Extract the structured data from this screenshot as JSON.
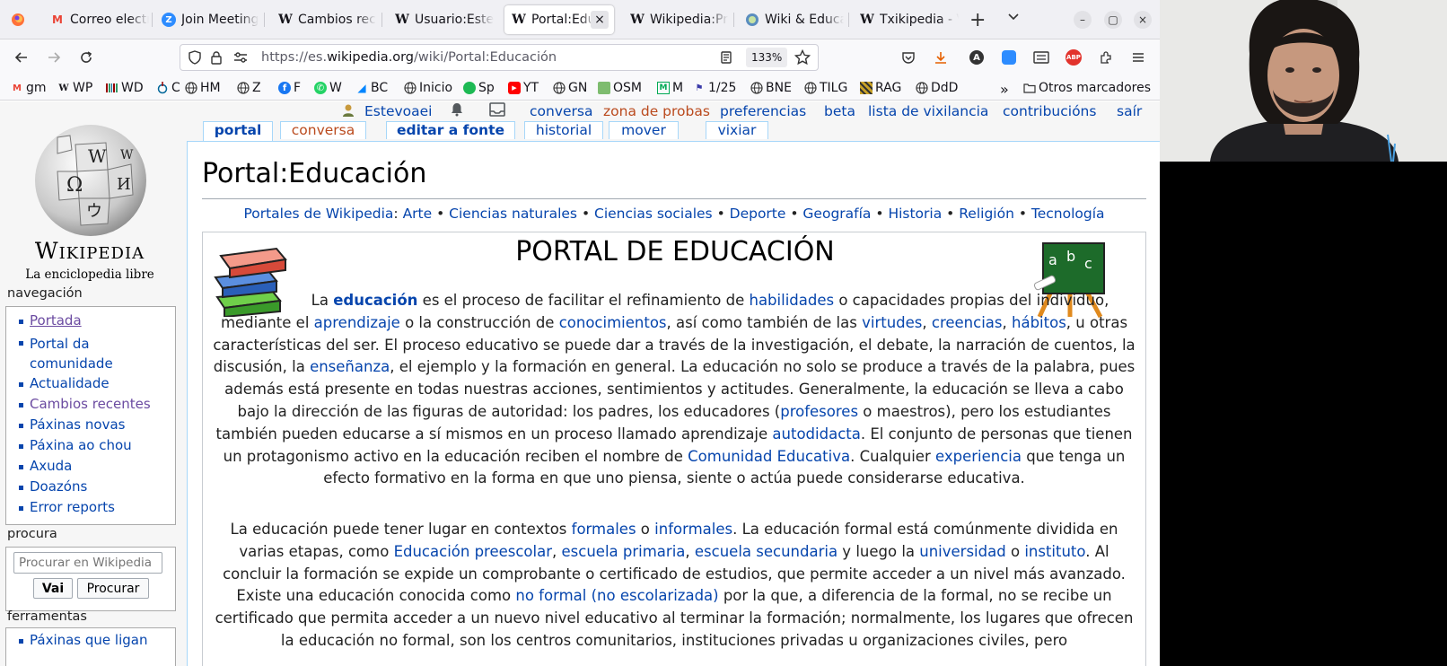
{
  "tabs": [
    {
      "title": "",
      "icon": "firefox-icon"
    },
    {
      "title": "Correo electró",
      "icon": "gmail-icon"
    },
    {
      "title": "Join Meeting",
      "icon": "zoom-icon"
    },
    {
      "title": "Cambios rec",
      "icon": "wikipedia-icon"
    },
    {
      "title": "Usuario:Este",
      "icon": "wikipedia-icon"
    },
    {
      "title": "Portal:Edu",
      "icon": "wikipedia-icon",
      "active": true
    },
    {
      "title": "Wikipedia:Pr",
      "icon": "wikipedia-icon"
    },
    {
      "title": "Wiki & Educa",
      "icon": "wiki-education-icon"
    },
    {
      "title": "Txikipedia - V",
      "icon": "wikipedia-icon"
    }
  ],
  "window_controls": {
    "minimize": "–",
    "maximize": "▢",
    "close": "×"
  },
  "navbar": {
    "url_prefix": "https://es.",
    "url_domain": "wikipedia.org",
    "url_path": "/wiki/Portal:Educación",
    "zoom": "133%"
  },
  "bookmarks": [
    {
      "label": "gm",
      "icon": "gmail-icon"
    },
    {
      "label": "WP",
      "icon": "wikipedia-icon"
    },
    {
      "label": "WD",
      "icon": "wikidata-icon"
    },
    {
      "label": "C",
      "icon": "commons-icon"
    },
    {
      "label": "HM",
      "icon": "globe-icon"
    },
    {
      "label": "Z",
      "icon": "globe-icon"
    },
    {
      "label": "F",
      "icon": "facebook-icon"
    },
    {
      "label": "W",
      "icon": "whatsapp-icon"
    },
    {
      "label": "BC",
      "icon": "bluesky-icon"
    },
    {
      "label": "Inicio",
      "icon": "globe-icon"
    },
    {
      "label": "Sp",
      "icon": "spotify-icon"
    },
    {
      "label": "YT",
      "icon": "youtube-icon"
    },
    {
      "label": "GN",
      "icon": "globe-icon"
    },
    {
      "label": "OSM",
      "icon": "osm-icon"
    },
    {
      "label": "M",
      "icon": "m-icon"
    },
    {
      "label": "1/25",
      "icon": "flag-icon"
    },
    {
      "label": "BNE",
      "icon": "globe-icon"
    },
    {
      "label": "TILG",
      "icon": "globe-icon"
    },
    {
      "label": "RAG",
      "icon": "rag-icon"
    },
    {
      "label": "DdD",
      "icon": "globe-icon"
    }
  ],
  "bookmarks_overflow": "»",
  "other_bookmarks": "Otros marcadores",
  "personal": {
    "user": "Estevoaei",
    "talk": "conversa",
    "sandbox": "zona de probas",
    "preferences": "preferencias",
    "beta": "beta",
    "watchlist": "lista de vixilancia",
    "contributions": "contribucións",
    "logout": "saír"
  },
  "page_tabs": {
    "portal": "portal",
    "talk": "conversa",
    "edit": "editar a fonte",
    "history": "historial",
    "move": "mover",
    "watch": "vixiar"
  },
  "logo": {
    "wordmark": "Wikipedia",
    "tagline": "La enciclopedia libre"
  },
  "sidebar": {
    "nav_heading": "navegación",
    "nav_items": [
      "Portada",
      "Portal da comunidade",
      "Actualidade",
      "Cambios recentes",
      "Páxinas novas",
      "Páxina ao chou",
      "Axuda",
      "Doazóns",
      "Error reports"
    ],
    "search_heading": "procura",
    "search_placeholder": "Procurar en Wikipedia",
    "go_button": "Vai",
    "search_button": "Procurar",
    "tools_heading": "ferramentas",
    "tools_first": "Páxinas que ligan"
  },
  "content": {
    "title": "Portal:Educación",
    "portals_prefix": "Portales de Wikipedia",
    "portals": [
      "Arte",
      "Ciencias naturales",
      "Ciencias sociales",
      "Deporte",
      "Geografía",
      "Historia",
      "Religión",
      "Tecnología"
    ],
    "frame_title": "PORTAL DE EDUCACIÓN"
  }
}
